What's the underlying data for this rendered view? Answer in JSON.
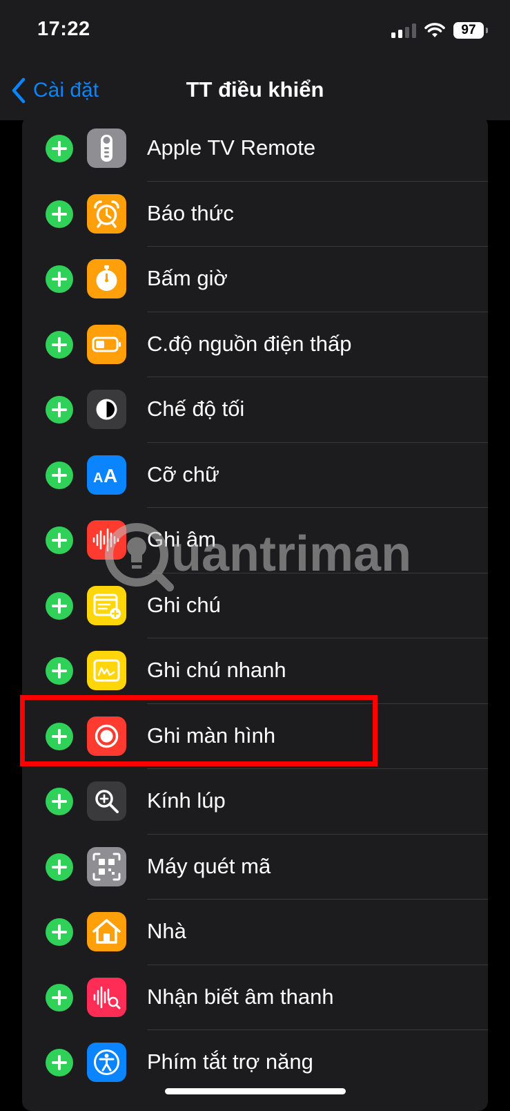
{
  "status_bar": {
    "time": "17:22",
    "battery": "97",
    "signal_bars_active": 2,
    "signal_bars_total": 4
  },
  "nav": {
    "back_label": "Cài đặt",
    "title": "TT điều khiển"
  },
  "accent_color": "#0a84ff",
  "add_color": "#30d158",
  "highlight_color": "#ff0000",
  "controls": [
    {
      "label": "Apple TV Remote",
      "icon": "apple-tv-remote-icon",
      "color": "#8e8e93"
    },
    {
      "label": "Báo thức",
      "icon": "alarm-icon",
      "color": "#ff9f0a"
    },
    {
      "label": "Bấm giờ",
      "icon": "stopwatch-icon",
      "color": "#ff9f0a"
    },
    {
      "label": "C.độ nguồn điện thấp",
      "icon": "low-power-battery-icon",
      "color": "#ff9f0a"
    },
    {
      "label": "Chế độ tối",
      "icon": "dark-mode-icon",
      "color": "#3a3a3c"
    },
    {
      "label": "Cỡ chữ",
      "icon": "text-size-icon",
      "color": "#0a84ff"
    },
    {
      "label": "Ghi âm",
      "icon": "voice-memos-icon",
      "color": "#ff3b30"
    },
    {
      "label": "Ghi chú",
      "icon": "notes-icon",
      "color": "#ffd60a"
    },
    {
      "label": "Ghi chú nhanh",
      "icon": "quick-note-icon",
      "color": "#ffd60a"
    },
    {
      "label": "Ghi màn hình",
      "icon": "screen-recording-icon",
      "color": "#ff3b30"
    },
    {
      "label": "Kính lúp",
      "icon": "magnifier-icon",
      "color": "#3a3a3c"
    },
    {
      "label": "Máy quét mã",
      "icon": "code-scanner-icon",
      "color": "#8e8e93"
    },
    {
      "label": "Nhà",
      "icon": "home-icon",
      "color": "#ff9f0a"
    },
    {
      "label": "Nhận biết âm thanh",
      "icon": "sound-recognition-icon",
      "color": "#ff2d55"
    },
    {
      "label": "Phím tắt trợ năng",
      "icon": "accessibility-shortcut-icon",
      "color": "#0a84ff"
    }
  ],
  "highlighted_index": 9,
  "watermark": "uantrimang"
}
